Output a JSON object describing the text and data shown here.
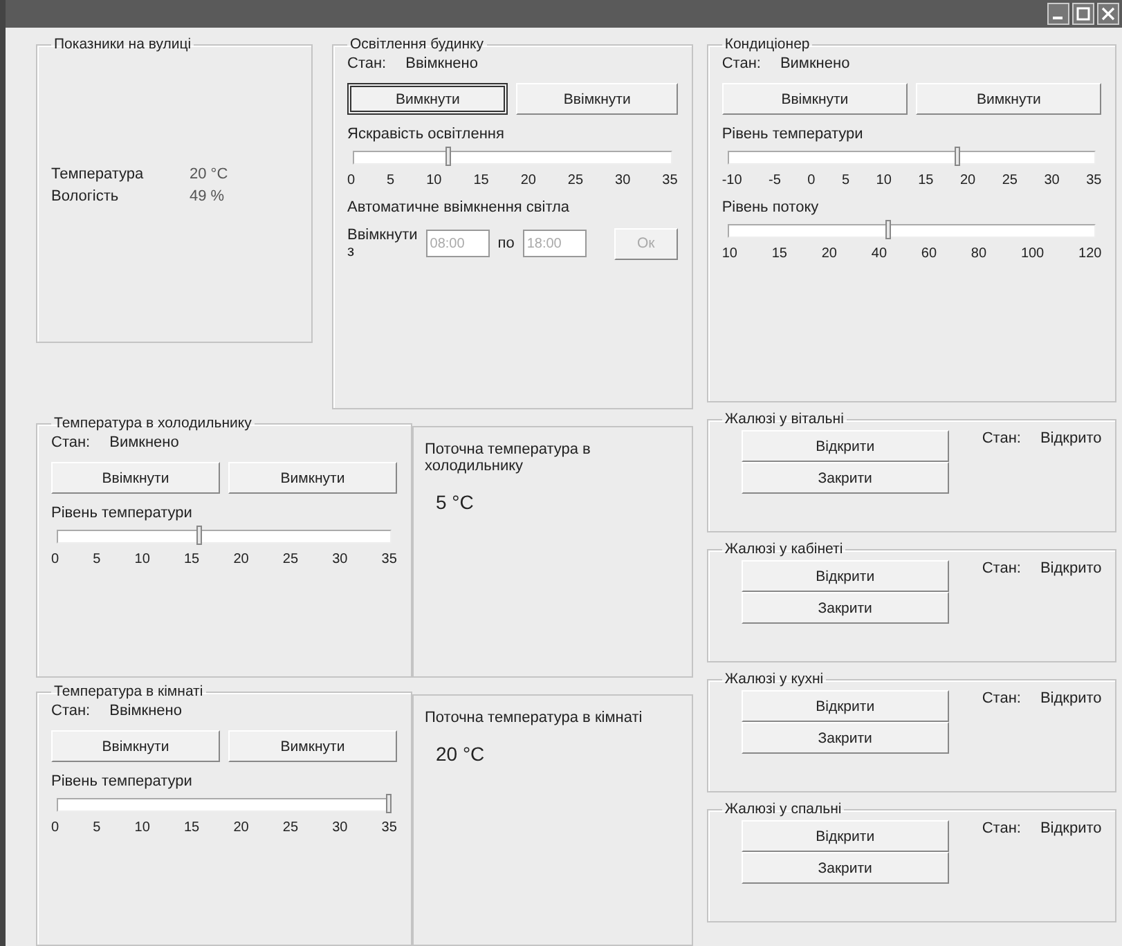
{
  "outdoor": {
    "title": "Показники на вулиці",
    "rows": [
      {
        "label": "Температура",
        "value": "20 °C"
      },
      {
        "label": "Вологість",
        "value": "49 %"
      }
    ]
  },
  "lighting": {
    "title": "Освітлення будинку",
    "state_label": "Стан:",
    "state": "Ввімкнено",
    "buttons": [
      {
        "label": "Вимкнути",
        "focused": true
      },
      {
        "label": "Ввімкнути",
        "focused": false
      }
    ],
    "slider": {
      "label": "Яскравість освітлення",
      "level": 0.3,
      "ticks": [
        "0",
        "5",
        "10",
        "15",
        "20",
        "25",
        "30",
        "35"
      ]
    },
    "auto": {
      "title": "Автоматичне ввімкнення світла",
      "from_label": "Ввімкнути з",
      "from": "08:00",
      "to_label": "по",
      "to": "18:00",
      "apply": {
        "label": "Ок",
        "disabled": true
      }
    }
  },
  "conditioner": {
    "title": "Кондиціонер",
    "state_label": "Стан:",
    "state": "Вимкнено",
    "buttons": [
      {
        "label": "Ввімкнути",
        "focused": false
      },
      {
        "label": "Вимкнути",
        "focused": false
      }
    ],
    "sliders": [
      {
        "label": "Рівень температури",
        "level": 0.63,
        "ticks": [
          "-10",
          "-5",
          "0",
          "5",
          "10",
          "15",
          "20",
          "25",
          "30",
          "35"
        ]
      },
      {
        "label": "Рівень потоку",
        "level": 0.44,
        "ticks": [
          "10",
          "15",
          "20",
          "40",
          "60",
          "80",
          "100",
          "120"
        ]
      }
    ]
  },
  "devices": [
    {
      "title": "Температура в холодильнику",
      "state_label": "Стан:",
      "state": "Вимкнено",
      "buttons": [
        {
          "label": "Ввімкнути",
          "focused": false
        },
        {
          "label": "Вимкнути",
          "focused": false
        }
      ],
      "slider": {
        "label": "Рівень температури",
        "level": 0.43,
        "ticks": [
          "0",
          "5",
          "10",
          "15",
          "20",
          "25",
          "30",
          "35"
        ]
      },
      "reading_label": "Поточна температура в холодильнику",
      "reading": "5 °C"
    },
    {
      "title": "Температура в кімнаті",
      "state_label": "Стан:",
      "state": "Ввімкнено",
      "buttons": [
        {
          "label": "Ввімкнути",
          "focused": false
        },
        {
          "label": "Вимкнути",
          "focused": false
        }
      ],
      "slider": {
        "label": "Рівень температури",
        "level": 1.0,
        "ticks": [
          "0",
          "5",
          "10",
          "15",
          "20",
          "25",
          "30",
          "35"
        ]
      },
      "reading_label": "Поточна температура в кімнаті",
      "reading": "20 °C"
    }
  ],
  "blinds": [
    {
      "title": "Жалюзі у вітальні",
      "buttons": [
        "Відкрити",
        "Закрити"
      ],
      "state_label": "Стан:",
      "state": "Відкрито"
    },
    {
      "title": "Жалюзі у кабінеті",
      "buttons": [
        "Відкрити",
        "Закрити"
      ],
      "state_label": "Стан:",
      "state": "Відкрито"
    },
    {
      "title": "Жалюзі у кухні",
      "buttons": [
        "Відкрити",
        "Закрити"
      ],
      "state_label": "Стан:",
      "state": "Відкрито"
    },
    {
      "title": "Жалюзі у спальні",
      "buttons": [
        "Відкрити",
        "Закрити"
      ],
      "state_label": "Стан:",
      "state": "Відкрито"
    }
  ]
}
